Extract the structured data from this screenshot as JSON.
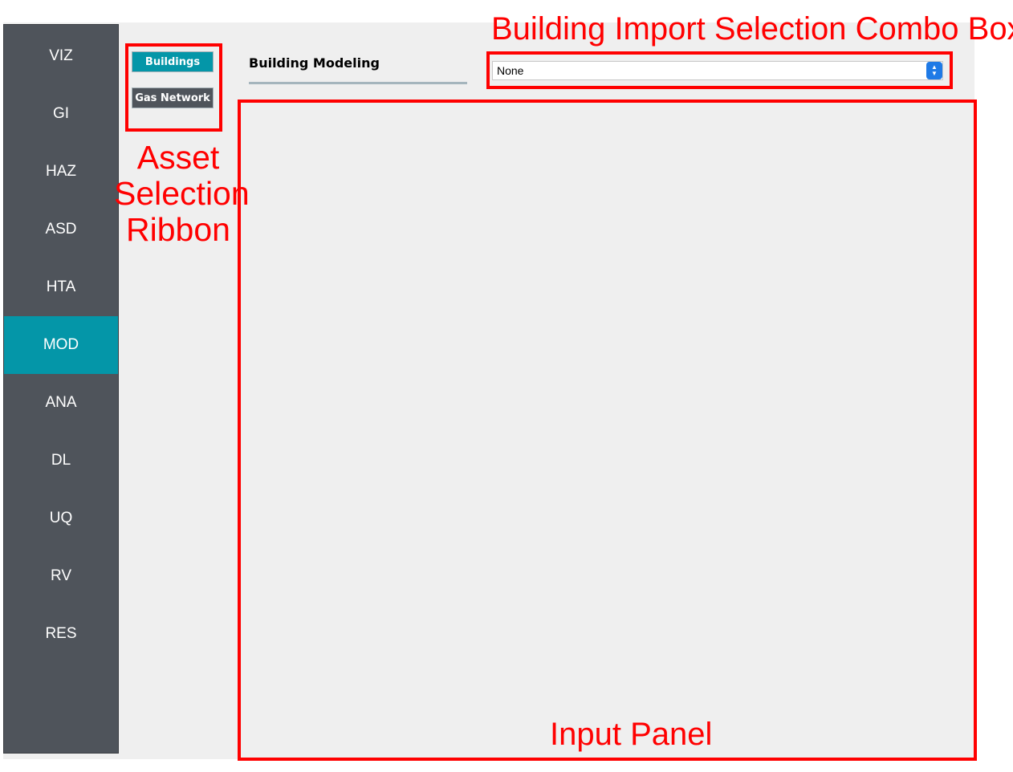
{
  "sidebar": {
    "items": [
      {
        "label": "VIZ",
        "active": false
      },
      {
        "label": "GI",
        "active": false
      },
      {
        "label": "HAZ",
        "active": false
      },
      {
        "label": "ASD",
        "active": false
      },
      {
        "label": "HTA",
        "active": false
      },
      {
        "label": "MOD",
        "active": true
      },
      {
        "label": "ANA",
        "active": false
      },
      {
        "label": "DL",
        "active": false
      },
      {
        "label": "UQ",
        "active": false
      },
      {
        "label": "RV",
        "active": false
      },
      {
        "label": "RES",
        "active": false
      }
    ]
  },
  "ribbon": {
    "buttons": [
      {
        "label": "Buildings",
        "selected": true
      },
      {
        "label": "Gas Network",
        "selected": false
      }
    ]
  },
  "main": {
    "title": "Building Modeling",
    "combo": {
      "value": "None"
    }
  },
  "annotations": {
    "asset_ribbon": "Asset Selection Ribbon",
    "combo_box": "Building Import Selection Combo Box",
    "input_panel": "Input Panel"
  },
  "colors": {
    "sidebar_bg": "#4f545b",
    "accent": "#0496a8",
    "panel_bg": "#efefef",
    "annotation_red": "#ff0000"
  }
}
